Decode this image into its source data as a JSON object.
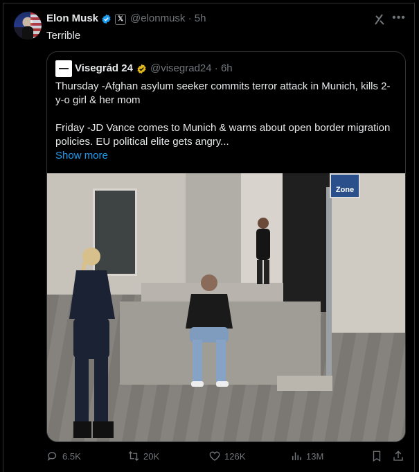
{
  "post": {
    "author_name": "Elon Musk",
    "author_handle": "@elonmusk",
    "separator": "·",
    "time": "5h",
    "text": "Terrible"
  },
  "quote": {
    "author_name": "Visegrád 24",
    "author_handle": "@visegrad24",
    "separator": "·",
    "time": "6h",
    "line1": "Thursday -Afghan asylum seeker commits terror attack in Munich, kills 2-y-o girl & her mom",
    "line2": "Friday -JD Vance comes to Munich & warns about open border migration policies. EU political elite gets angry...",
    "show_more": "Show more",
    "photo_sign": "Zone"
  },
  "actions": {
    "replies": "6.5K",
    "reposts": "20K",
    "likes": "126K",
    "views": "13M"
  },
  "colors": {
    "background": "#000000",
    "text": "#e7e9ea",
    "muted": "#71767b",
    "link": "#1d9bf0",
    "border": "#2f3336",
    "verified_blue": "#1d9bf0",
    "verified_gold": "#e2b719"
  },
  "icons": [
    "verified-badge-icon",
    "x-affiliate-icon",
    "grok-icon",
    "more-icon",
    "reply-icon",
    "repost-icon",
    "like-icon",
    "views-icon",
    "bookmark-icon",
    "share-icon"
  ]
}
